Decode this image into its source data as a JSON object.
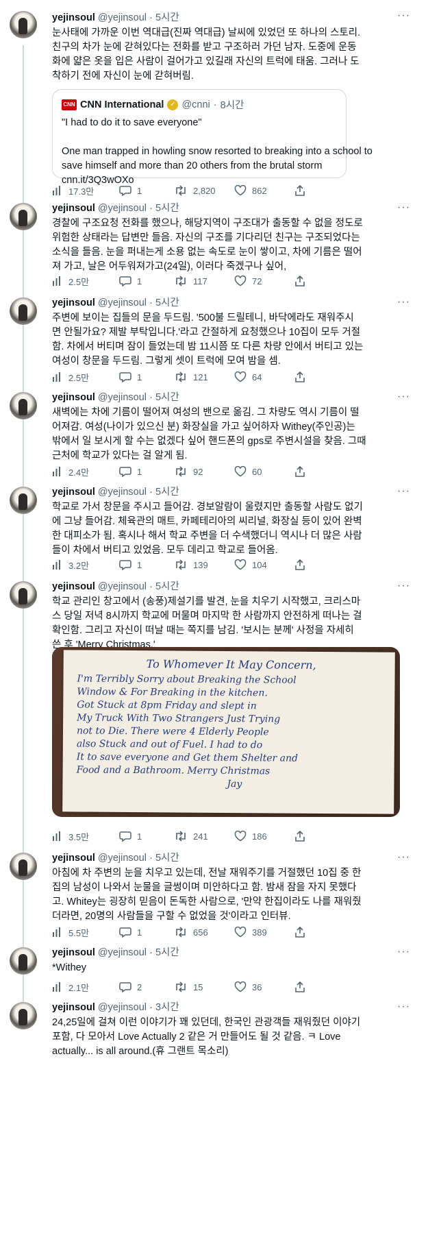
{
  "colors": {
    "text": "#0f1419",
    "secondary": "#536471",
    "rail": "#cfd9de",
    "cnn_red": "#cc0000",
    "verified_gold": "#e2b719"
  },
  "icons": {
    "views": "bar-chart-icon",
    "reply": "speech-bubble-icon",
    "retweet": "retweet-icon",
    "like": "heart-icon",
    "share": "share-icon",
    "more": "ellipsis-icon"
  },
  "tweets": [
    {
      "name": "yejinsoul",
      "handle": "@yejinsoul",
      "dot": "·",
      "time": "5시간",
      "more": "···",
      "lines": [
        "눈사태에 가까운 이번 역대급(진짜 역대급) 날씨에 있었던 또 하나의 스토리.",
        "친구의 차가 눈에 갇혀있다는 전화를 받고 구조하러 가던 남자. 도중에 운동",
        "화에 얇은 옷을 입은 사람이 걸어가고 있길래 자신의 트럭에 태움. 그러나 도",
        "착하기 전에 자신이 눈에 갇혀버림."
      ],
      "quote": {
        "logo": "CNN",
        "name": "CNN International",
        "verified": "✓",
        "handle": "@cnni",
        "dot": "·",
        "time": "8시간",
        "lines": [
          "\"I had to do it to save everyone\"",
          "",
          "One man trapped in howling snow resorted to breaking into a school to",
          "save himself and more than 20 others from the brutal storm",
          "cnn.it/3Q3wOXo"
        ]
      },
      "stats": {
        "views": "17.3만",
        "replies": "1",
        "retweets": "2,820",
        "likes": "862"
      }
    },
    {
      "name": "yejinsoul",
      "handle": "@yejinsoul",
      "dot": "·",
      "time": "5시간",
      "more": "···",
      "lines": [
        "경찰에 구조요청 전화를 했으나, 해당지역이 구조대가 출동할 수 없을 정도로",
        "위험한 상태라는 답변만 들음. 자신의 구조를 기다리던 친구는 구조되었다는",
        "소식을 들음. 눈을 퍼내는게 소용 없는 속도로 눈이 쌓이고, 차에 기름은 떨어",
        "져 가고, 날은 어두워져가고(24일), 이러다 죽겠구나 싶어,"
      ],
      "stats": {
        "views": "2.5만",
        "replies": "1",
        "retweets": "117",
        "likes": "72"
      }
    },
    {
      "name": "yejinsoul",
      "handle": "@yejinsoul",
      "dot": "·",
      "time": "5시간",
      "more": "···",
      "lines": [
        "주변에 보이는 집들의 문을 두드림. '500불 드릴테니, 바닥에라도 재워주시",
        "면 안될가요? 제발 부탁입니다.'라고 간절하게 요청했으나 10집이 모두 거절",
        "함. 차에서 버티며 잠이 들었는데 밤 11시쯤 또 다른 차량 안에서 버티고 있는",
        "여성이 창문을 두드림. 그렇게 셋이 트럭에 모여 밤을 셈."
      ],
      "stats": {
        "views": "2.5만",
        "replies": "1",
        "retweets": "121",
        "likes": "64"
      }
    },
    {
      "name": "yejinsoul",
      "handle": "@yejinsoul",
      "dot": "·",
      "time": "5시간",
      "more": "···",
      "lines": [
        "새벽에는 차에 기름이 떨어져 여성의 밴으로 옮김. 그 차량도 역시 기름이 떨",
        "어져감. 여성(나이가 있으신 분) 화장실을 가고 싶어하자 Withey(주인공)는",
        "밖에서 일 보시게 할 수는 없겠다 싶어 핸드폰의 gps로 주변시설을 찾음. 그때",
        "근처에 학교가 있다는 걸 알게 됨."
      ],
      "stats": {
        "views": "2.4만",
        "replies": "1",
        "retweets": "92",
        "likes": "60"
      }
    },
    {
      "name": "yejinsoul",
      "handle": "@yejinsoul",
      "dot": "·",
      "time": "5시간",
      "more": "···",
      "lines": [
        "학교로 가서 창문을 주시고 들어감. 경보알람이 울렸지만 출동할 사람도 없기",
        "에 그냥 들어감. 체육관의 매트, 카페테리아의 씨리널, 화장실 등이 있어 완벽",
        "한 대피소가 됨. 혹시나 해서 학교 주변을 더 수색했더니 역시나 더 많은 사람",
        "들이 차에서 버티고 있었음. 모두 데리고 학교로 들어옴."
      ],
      "stats": {
        "views": "3.2만",
        "replies": "1",
        "retweets": "139",
        "likes": "104"
      }
    },
    {
      "name": "yejinsoul",
      "handle": "@yejinsoul",
      "dot": "·",
      "time": "5시간",
      "more": "···",
      "lines": [
        "학교 관리인 창고에서 (송풍)제설기를 발견, 눈을 치우기 시작했고, 크리스마",
        "스 당일 저녁 8시까지 학교에 머물며 마지막 한 사람까지 안전하게 떠나는 걸",
        "확인함. 그리고 자신이 떠날 때는 쪽지를 남김. '보시는 분께' 사정을 자세히",
        "쓴 후 'Merry Christmas.'"
      ],
      "note": [
        "To Whomever It May Concern,",
        "I'm Terribly Sorry about Breaking the School",
        "Window & For Breaking in the kitchen.",
        "Got Stuck at 8pm Friday and slept in",
        "My Truck With Two Strangers Just Trying",
        "not to Die. There were 4 Elderly People",
        "also Stuck and out of Fuel. I had to do",
        "It to save everyone and Get them Shelter and",
        "Food and a Bathroom. Merry Christmas",
        "Jay"
      ],
      "stats": {
        "views": "3.5만",
        "replies": "1",
        "retweets": "241",
        "likes": "186"
      }
    },
    {
      "name": "yejinsoul",
      "handle": "@yejinsoul",
      "dot": "·",
      "time": "5시간",
      "more": "···",
      "lines": [
        "아침에 차 주변의 눈을 치우고 있는데, 전날 재워주기를 거절했던 10집 중 한",
        "집의 남성이 나와서 눈물을 글썽이며 미안하다고 함. 밤새 잠을 자지 못했다",
        "고. Whitey는 굉장히 믿음이 돈독한 사람으로, '만약 한집이라도 나를 재워줬",
        "더라면, 20명의 사람들을 구할 수 없었을 것'이라고 인터뷰."
      ],
      "stats": {
        "views": "5.5만",
        "replies": "1",
        "retweets": "656",
        "likes": "389"
      }
    },
    {
      "name": "yejinsoul",
      "handle": "@yejinsoul",
      "dot": "·",
      "time": "5시간",
      "more": "···",
      "lines": [
        "*Withey"
      ],
      "stats": {
        "views": "2.1만",
        "replies": "2",
        "retweets": "15",
        "likes": "36"
      }
    },
    {
      "name": "yejinsoul",
      "handle": "@yejinsoul",
      "dot": "·",
      "time": "3시간",
      "more": "···",
      "lines": [
        "24,25일에 걸쳐 이런 이야기가 꽤 있던데, 한국인 관광객들 재워줬던 이야기",
        "포함, 다 모아서 Love Actually 2 같은 거 만들어도 될 것 같음. ㅋ Love",
        "actually... is all around.(휴 그랜트 목소리)"
      ]
    }
  ]
}
